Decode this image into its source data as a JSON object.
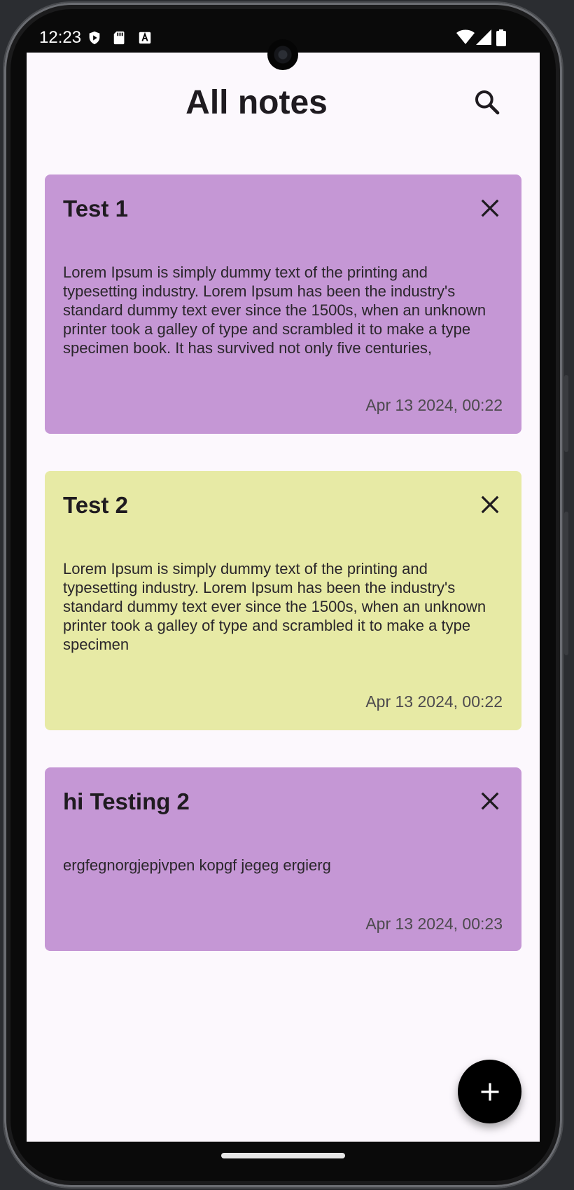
{
  "status_bar": {
    "time": "12:23",
    "left_icons": [
      "shield-icon",
      "sd-card-icon",
      "keyboard-a-icon"
    ],
    "right_icons": [
      "wifi-icon",
      "signal-icon",
      "battery-icon"
    ]
  },
  "header": {
    "title": "All notes",
    "search_icon": "search-icon"
  },
  "notes": [
    {
      "title": "Test 1",
      "body": "Lorem Ipsum is simply dummy text of the printing and typesetting industry. Lorem Ipsum has been the industry's standard dummy text ever since the 1500s, when an unknown printer took a galley of type and scrambled it to make a type specimen book. It has survived not only five centuries,",
      "date": "Apr 13 2024, 00:22",
      "color": "#c597d5"
    },
    {
      "title": "Test 2",
      "body": "Lorem Ipsum is simply dummy text of the printing and typesetting industry. Lorem Ipsum has been the industry's standard dummy text ever since the 1500s, when an unknown printer took a galley of type and scrambled it to make a type specimen",
      "date": "Apr 13 2024, 00:22",
      "color": "#e7eaa5"
    },
    {
      "title": "hi Testing 2",
      "body": "ergfegnorgjepjvpen kopgf jegeg ergierg",
      "date": "Apr 13 2024, 00:23",
      "color": "#c597d5"
    }
  ],
  "fab": {
    "icon": "plus-icon"
  },
  "colors": {
    "background": "#fcf8fd",
    "fab": "#000000",
    "text": "#1f1b20"
  }
}
